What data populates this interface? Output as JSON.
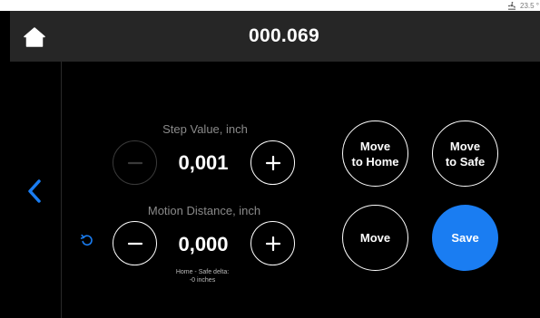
{
  "status": {
    "temperature": "23.5 °",
    "device_icon": "fan-icon"
  },
  "header": {
    "title": "000.069",
    "home_icon": "home-icon"
  },
  "nav": {
    "back_icon": "chevron-left-icon"
  },
  "step": {
    "label": "Step Value, inch",
    "value": "0,001",
    "decrease_enabled": false,
    "increase_enabled": true
  },
  "motion": {
    "label": "Motion Distance, inch",
    "value": "0,000",
    "reset_icon": "reset-icon",
    "delta_note_line1": "Home - Safe delta:",
    "delta_note_line2": "-0 inches"
  },
  "actions": {
    "move_home_line1": "Move",
    "move_home_line2": "to Home",
    "move_safe_line1": "Move",
    "move_safe_line2": "to Safe",
    "move_label": "Move",
    "save_label": "Save"
  },
  "colors": {
    "accent": "#1a7df2",
    "header_bg": "#262626",
    "background": "#000000",
    "muted_text": "#8a8a8a"
  }
}
